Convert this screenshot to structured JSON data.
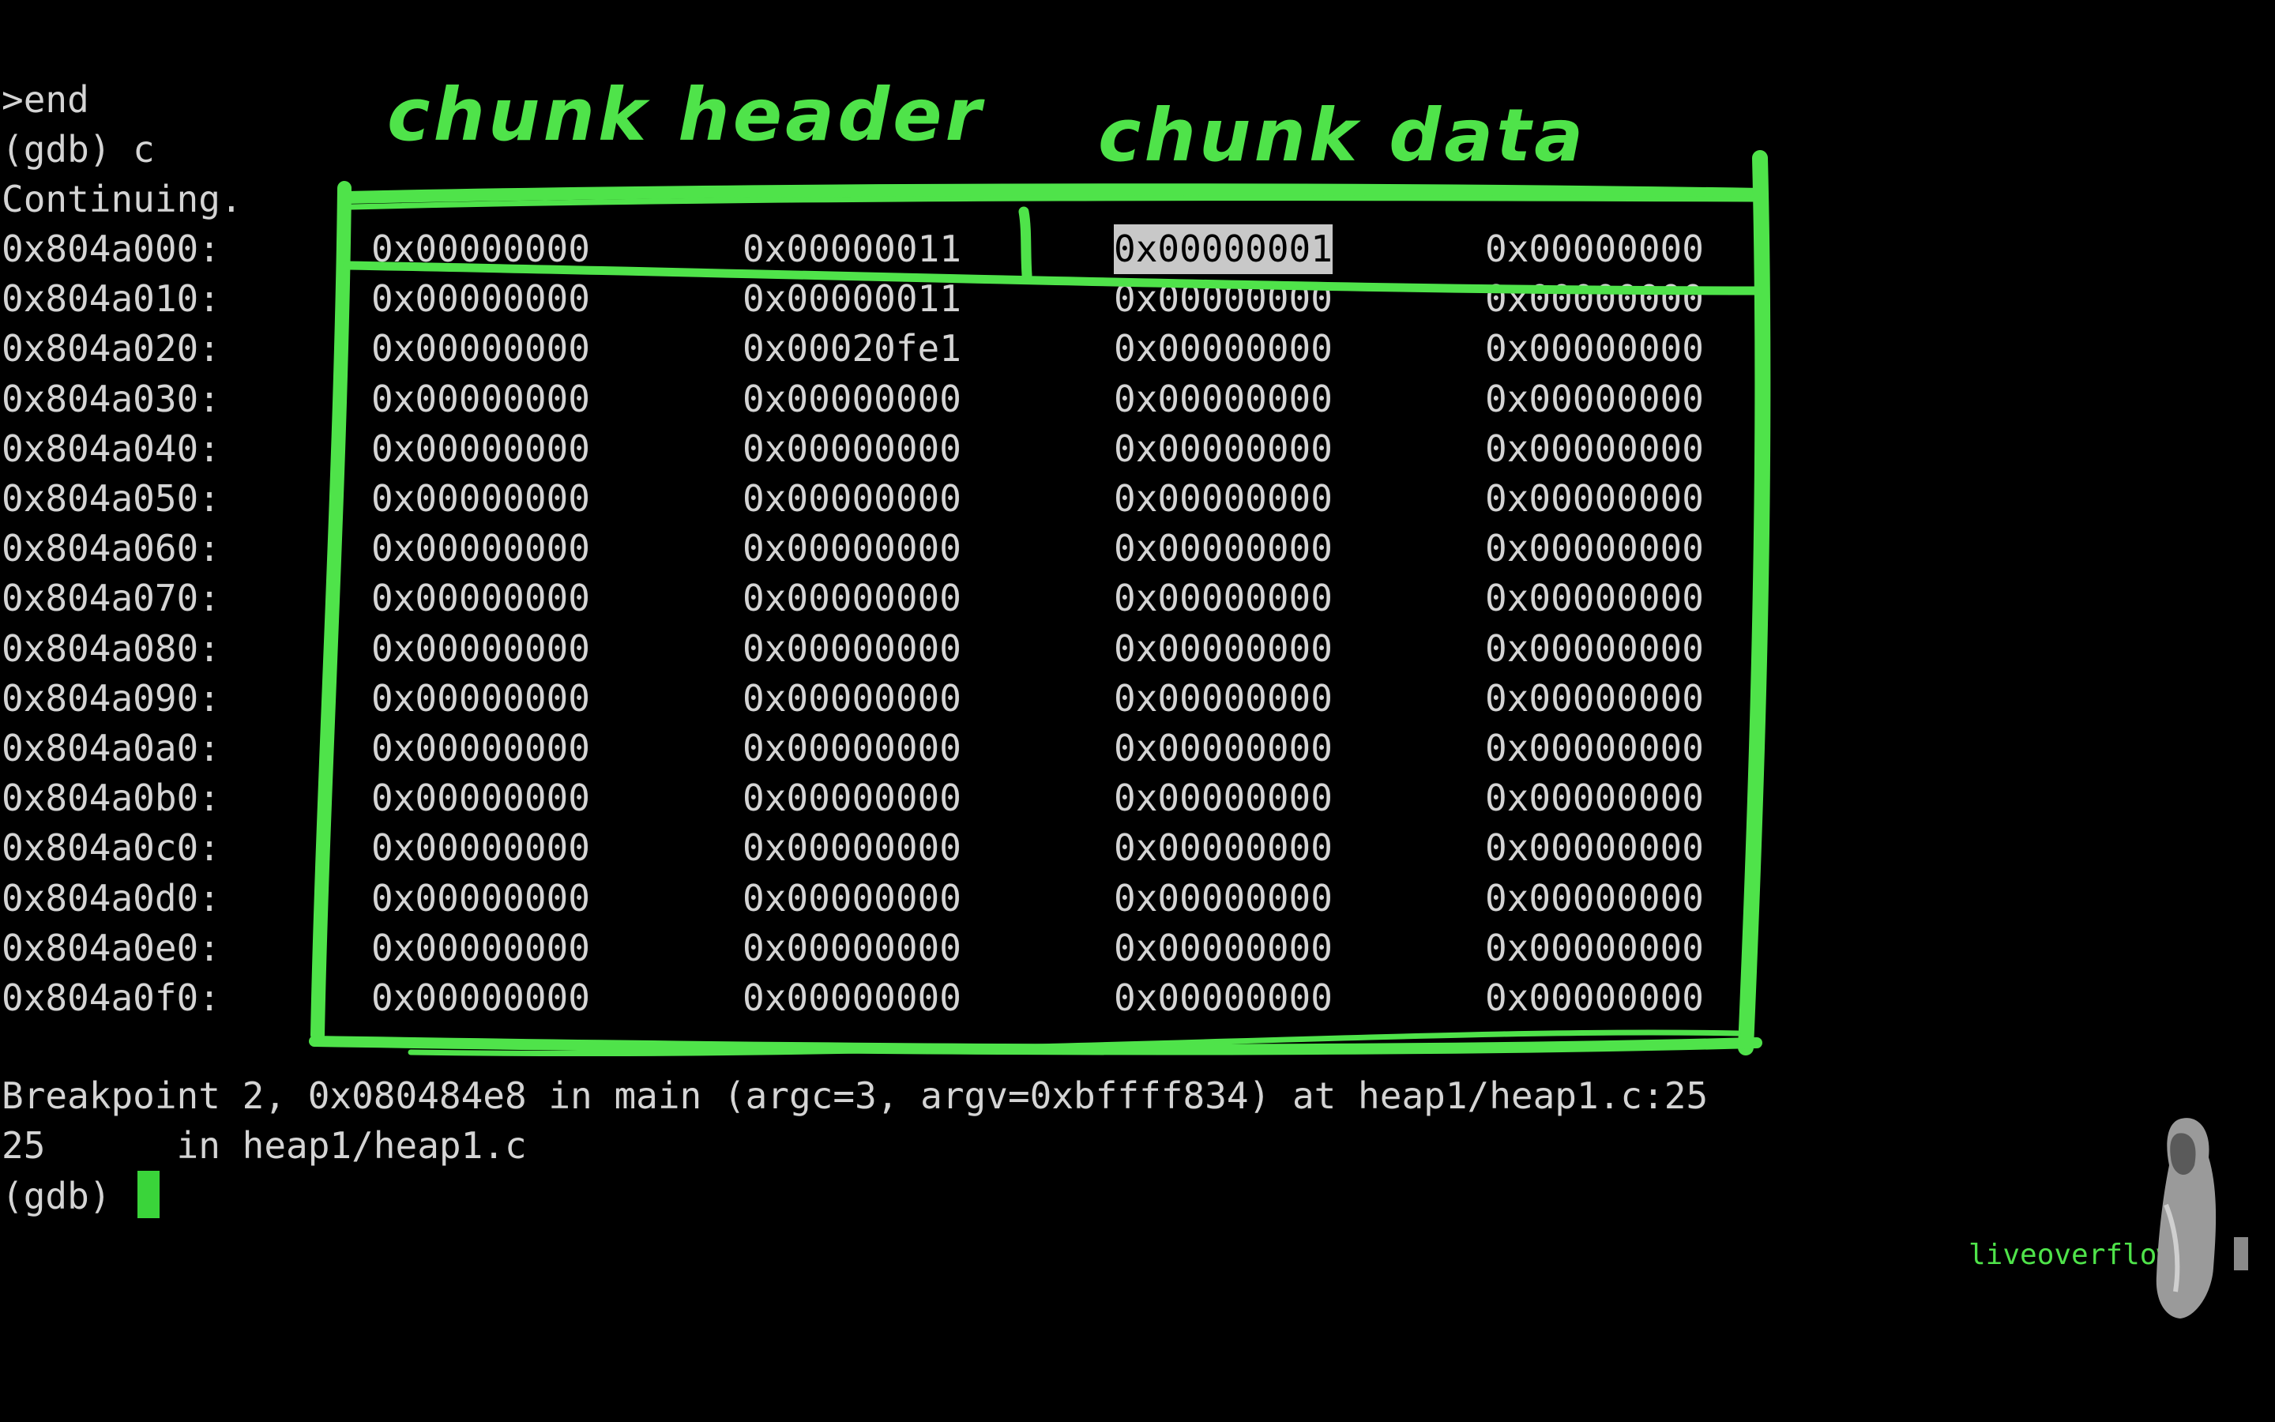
{
  "terminal": {
    "lines_before": [
      ">end",
      "(gdb) c",
      "Continuing."
    ],
    "memory_rows": [
      {
        "addr": "0x804a000:",
        "w0": "0x00000000",
        "w1": "0x00000011",
        "w2": "0x00000001",
        "w3": "0x00000000"
      },
      {
        "addr": "0x804a010:",
        "w0": "0x00000000",
        "w1": "0x00000011",
        "w2": "0x00000000",
        "w3": "0x00000000"
      },
      {
        "addr": "0x804a020:",
        "w0": "0x00000000",
        "w1": "0x00020fe1",
        "w2": "0x00000000",
        "w3": "0x00000000"
      },
      {
        "addr": "0x804a030:",
        "w0": "0x00000000",
        "w1": "0x00000000",
        "w2": "0x00000000",
        "w3": "0x00000000"
      },
      {
        "addr": "0x804a040:",
        "w0": "0x00000000",
        "w1": "0x00000000",
        "w2": "0x00000000",
        "w3": "0x00000000"
      },
      {
        "addr": "0x804a050:",
        "w0": "0x00000000",
        "w1": "0x00000000",
        "w2": "0x00000000",
        "w3": "0x00000000"
      },
      {
        "addr": "0x804a060:",
        "w0": "0x00000000",
        "w1": "0x00000000",
        "w2": "0x00000000",
        "w3": "0x00000000"
      },
      {
        "addr": "0x804a070:",
        "w0": "0x00000000",
        "w1": "0x00000000",
        "w2": "0x00000000",
        "w3": "0x00000000"
      },
      {
        "addr": "0x804a080:",
        "w0": "0x00000000",
        "w1": "0x00000000",
        "w2": "0x00000000",
        "w3": "0x00000000"
      },
      {
        "addr": "0x804a090:",
        "w0": "0x00000000",
        "w1": "0x00000000",
        "w2": "0x00000000",
        "w3": "0x00000000"
      },
      {
        "addr": "0x804a0a0:",
        "w0": "0x00000000",
        "w1": "0x00000000",
        "w2": "0x00000000",
        "w3": "0x00000000"
      },
      {
        "addr": "0x804a0b0:",
        "w0": "0x00000000",
        "w1": "0x00000000",
        "w2": "0x00000000",
        "w3": "0x00000000"
      },
      {
        "addr": "0x804a0c0:",
        "w0": "0x00000000",
        "w1": "0x00000000",
        "w2": "0x00000000",
        "w3": "0x00000000"
      },
      {
        "addr": "0x804a0d0:",
        "w0": "0x00000000",
        "w1": "0x00000000",
        "w2": "0x00000000",
        "w3": "0x00000000"
      },
      {
        "addr": "0x804a0e0:",
        "w0": "0x00000000",
        "w1": "0x00000000",
        "w2": "0x00000000",
        "w3": "0x00000000"
      },
      {
        "addr": "0x804a0f0:",
        "w0": "0x00000000",
        "w1": "0x00000000",
        "w2": "0x00000000",
        "w3": "0x00000000"
      }
    ],
    "selected_word": "0x00000001",
    "breakpoint_line": "Breakpoint 2, 0x080484e8 in main (argc=3, argv=0xbffff834) at heap1/heap1.c:25",
    "source_line": "25      in heap1/heap1.c",
    "prompt": "(gdb) "
  },
  "annotations": {
    "header_label": "chunk header",
    "data_label": "chunk data",
    "color": "#4fe34a"
  },
  "brand": {
    "name": "liveoverflow",
    "chevron": "»",
    "mascot_icon": "hooded-figure-icon"
  },
  "colors": {
    "background": "#000000",
    "text": "#d4d4d4",
    "cursor": "#3ad43a",
    "selection": "#c8c8c8"
  }
}
